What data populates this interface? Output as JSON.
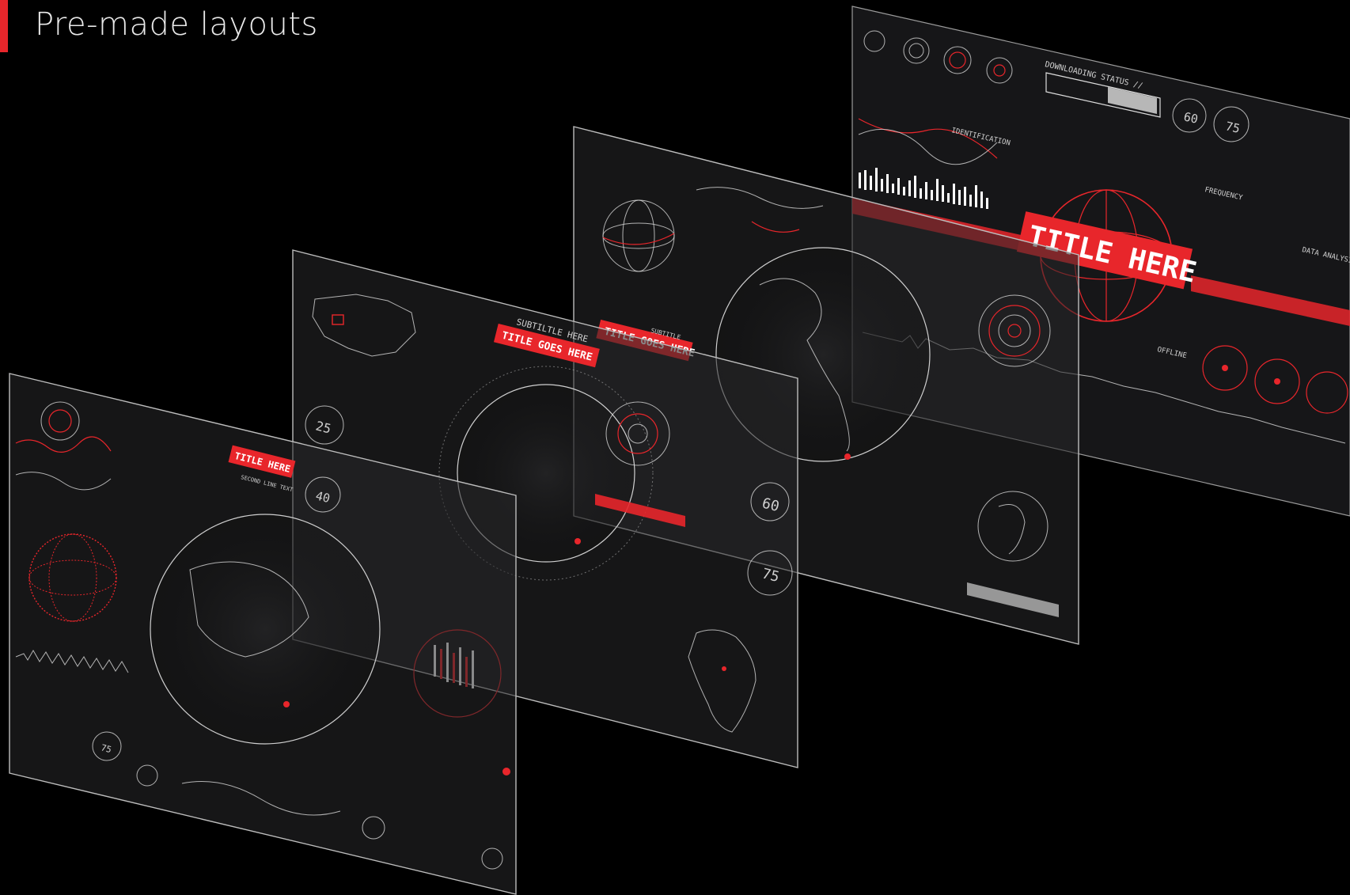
{
  "header": {
    "title": "Pre-made layouts"
  },
  "colors": {
    "accent": "#e8262b",
    "background": "#000000",
    "hud_line": "#d9d9d9"
  },
  "panels": [
    {
      "title": "TITLE HERE",
      "subtitle": "SECOND LINE TEXT",
      "gauges": [
        "40",
        "75"
      ]
    },
    {
      "title": "TITLE GOES HERE",
      "subtitle": "SUBTILTLE HERE",
      "gauges": [
        "25",
        "60",
        "75"
      ]
    },
    {
      "title": "TITLE GOES HERE",
      "subtitle": "SUBTITLE"
    },
    {
      "title": "TITLE HERE",
      "labels": [
        "DOWNLOADING STATUS //",
        "IDENTIFICATION",
        "FREQUENCY",
        "DATA ANALYSIS",
        "OFFLINE"
      ],
      "gauges": [
        "60",
        "75"
      ]
    }
  ]
}
